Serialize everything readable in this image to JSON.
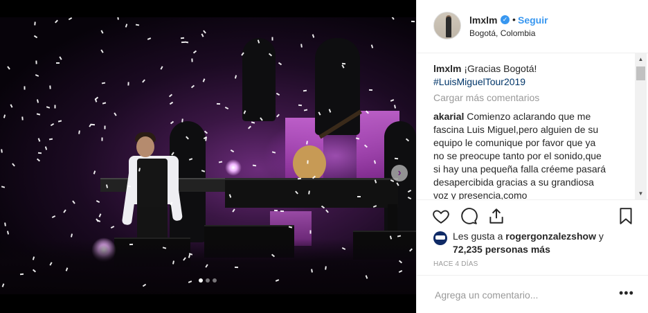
{
  "post": {
    "username": "lmxlm",
    "follow_label": "Seguir",
    "separator": "•",
    "location": "Bogotá, Colombia",
    "caption_user": "lmxlm",
    "caption_text": "¡Gracias Bogotá!",
    "hashtag": "#LuisMiguelTour2019",
    "load_more": "Cargar más comentarios",
    "comment_user": "akarial",
    "comment_text": "Comienzo aclarando que me fascina Luis Miguel,pero alguien de su equipo le comunique por favor que ya no se preocupe tanto por el sonido,que si hay una pequeña falla créeme pasará desapercibida gracias a su grandiosa voz y presencia,como",
    "likes_prefix": "Les gusta a",
    "likes_user": "rogergonzalezshow",
    "likes_suffix": "y",
    "likes_count": "72,235 personas más",
    "time_ago": "HACE 4 DÍAS",
    "comment_placeholder": "Agrega un comentario...",
    "more_label": "•••"
  },
  "media": {
    "next_label": "›",
    "carousel_count": 3,
    "carousel_active": 0
  },
  "icons": {
    "verified": "verified-badge-icon",
    "like": "heart-icon",
    "comment": "comment-bubble-icon",
    "share": "share-icon",
    "save": "bookmark-icon"
  },
  "colors": {
    "accent": "#3897f0",
    "text": "#262626",
    "muted": "#999999",
    "hashtag": "#003569"
  }
}
